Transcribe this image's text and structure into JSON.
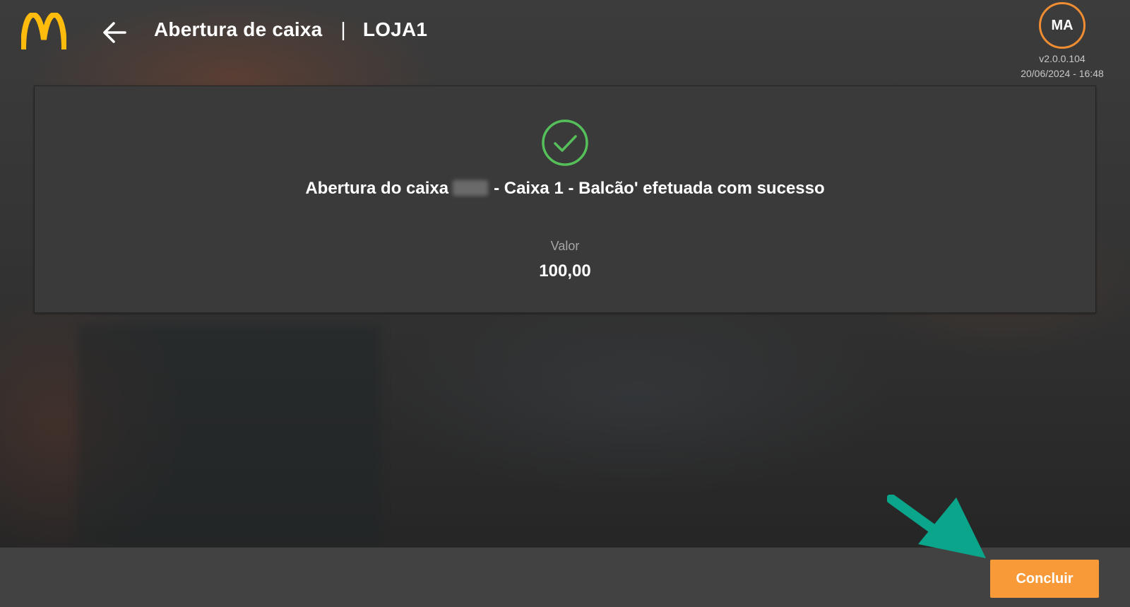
{
  "header": {
    "title": "Abertura de caixa",
    "separator": "|",
    "store": "LOJA1",
    "user_initials": "MA",
    "version": "v2.0.0.104",
    "datetime": "20/06/2024 - 16:48"
  },
  "confirmation": {
    "message_prefix": "Abertura do caixa",
    "message_suffix": "- Caixa 1 - Balcão' efetuada com sucesso",
    "value_label": "Valor",
    "value": "100,00"
  },
  "footer": {
    "conclude_label": "Concluir"
  },
  "colors": {
    "accent": "#f99a38",
    "avatar_ring": "#f08c32",
    "success": "#55c05a",
    "brand_yellow": "#ffbc0d",
    "annotation_arrow": "#0aa58a"
  },
  "icons": {
    "logo": "mcdonalds-arches-logo",
    "back": "arrow-left-icon",
    "success": "check-circle-icon",
    "annotation": "pointer-arrow-icon"
  }
}
